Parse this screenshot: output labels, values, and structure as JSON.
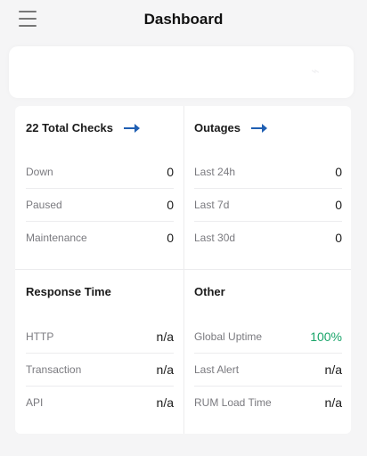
{
  "header": {
    "title": "Dashboard"
  },
  "cards": {
    "checks": {
      "title": "22 Total Checks",
      "rows": [
        {
          "label": "Down",
          "value": "0"
        },
        {
          "label": "Paused",
          "value": "0"
        },
        {
          "label": "Maintenance",
          "value": "0"
        }
      ]
    },
    "outages": {
      "title": "Outages",
      "rows": [
        {
          "label": "Last 24h",
          "value": "0"
        },
        {
          "label": "Last 7d",
          "value": "0"
        },
        {
          "label": "Last 30d",
          "value": "0"
        }
      ]
    },
    "response": {
      "title": "Response Time",
      "rows": [
        {
          "label": "HTTP",
          "value": "n/a"
        },
        {
          "label": "Transaction",
          "value": "n/a"
        },
        {
          "label": "API",
          "value": "n/a"
        }
      ]
    },
    "other": {
      "title": "Other",
      "rows": [
        {
          "label": "Global Uptime",
          "value": "100%"
        },
        {
          "label": "Last Alert",
          "value": "n/a"
        },
        {
          "label": "RUM Load Time",
          "value": "n/a"
        }
      ]
    }
  },
  "colors": {
    "accent": "#1f5fb3",
    "success": "#1aa56a",
    "background": "#f5f5f6"
  },
  "icons": {
    "menu": "hamburger-menu-icon",
    "arrow": "arrow-right-icon"
  }
}
